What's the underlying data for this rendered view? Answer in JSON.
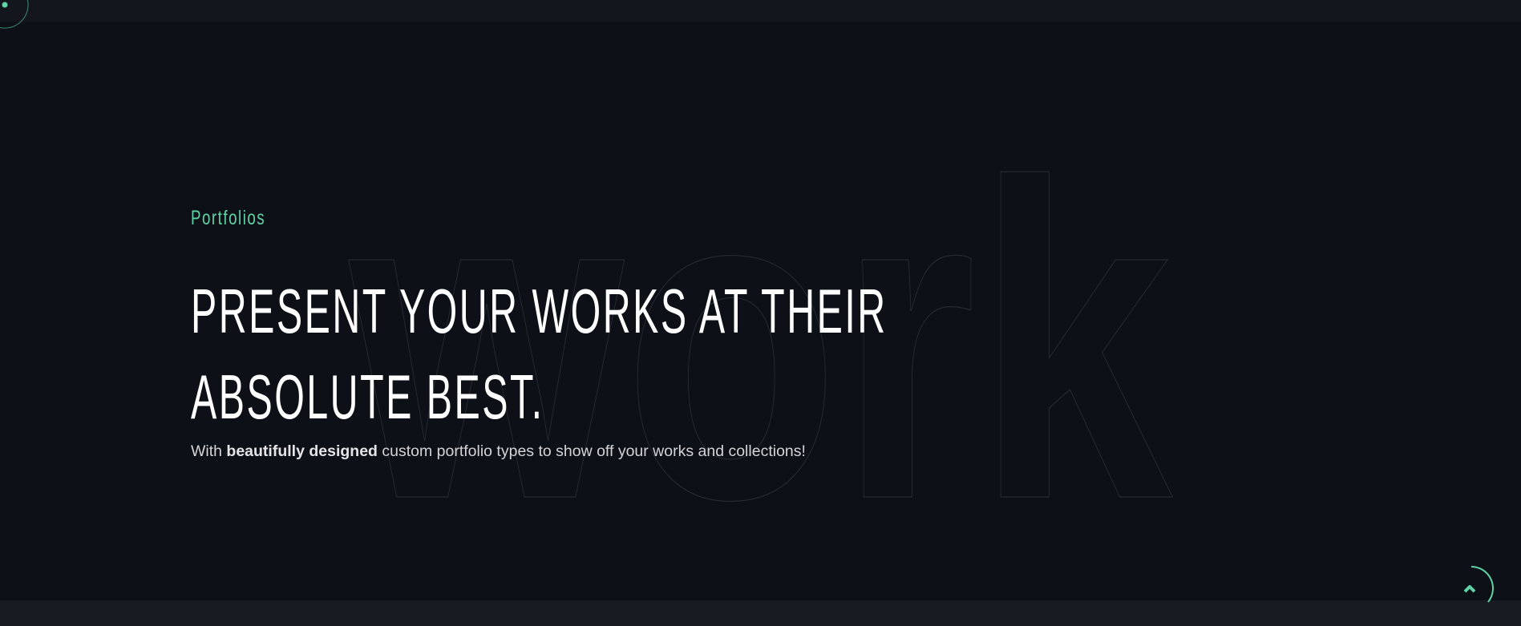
{
  "hero": {
    "background_word": "work",
    "eyebrow": "Portfolios",
    "heading_line1": "PRESENT YOUR WORKS AT THEIR",
    "heading_line2": "ABSOLUTE BEST.",
    "subtitle_prefix": "With ",
    "subtitle_bold": "beautifully designed",
    "subtitle_rest": " custom portfolio types to show off your works and collections!"
  },
  "colors": {
    "accent": "#5fd3a6",
    "background": "#0d1017",
    "text": "#ffffff"
  },
  "icons": {
    "cursor": "cursor-circle-icon",
    "scroll_top": "chevron-up-icon"
  }
}
